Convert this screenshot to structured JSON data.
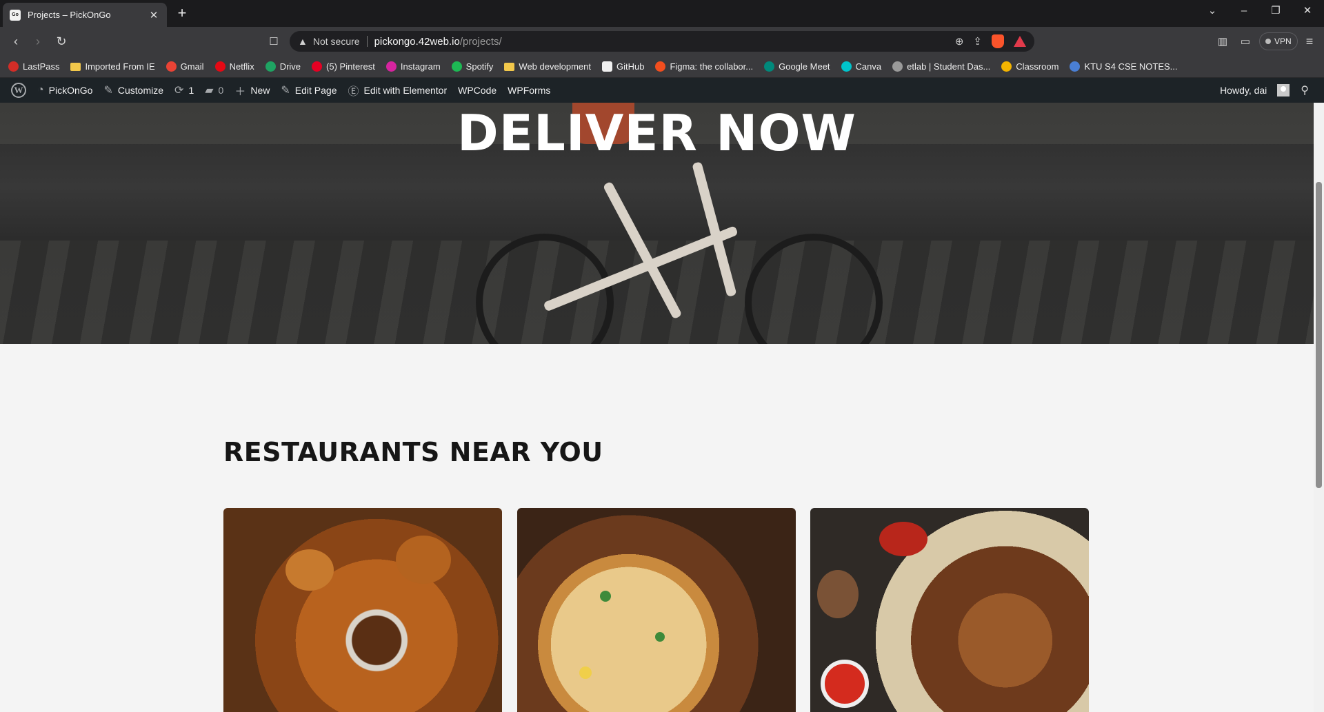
{
  "browser": {
    "tab": {
      "title": "Projects – PickOnGo",
      "favicon_text": "Go"
    },
    "url": {
      "security_label": "Not secure",
      "host": "pickongo.42web.io",
      "path": "/projects/"
    },
    "vpn_label": "VPN"
  },
  "bookmarks": [
    {
      "label": "LastPass",
      "icon": "lastpass-icon",
      "color": "#d32d27"
    },
    {
      "label": "Imported From IE",
      "icon": "folder-icon",
      "color": "#f2c84b"
    },
    {
      "label": "Gmail",
      "icon": "gmail-icon",
      "color": "#ea4335"
    },
    {
      "label": "Netflix",
      "icon": "netflix-icon",
      "color": "#e50914"
    },
    {
      "label": "Drive",
      "icon": "drive-icon",
      "color": "#1fa463"
    },
    {
      "label": "(5) Pinterest",
      "icon": "pinterest-icon",
      "color": "#e60023"
    },
    {
      "label": "Instagram",
      "icon": "instagram-icon",
      "color": "#d6249f"
    },
    {
      "label": "Spotify",
      "icon": "spotify-icon",
      "color": "#1db954"
    },
    {
      "label": "Web development",
      "icon": "folder-icon",
      "color": "#f2c84b"
    },
    {
      "label": "GitHub",
      "icon": "github-icon",
      "color": "#f0f0f0"
    },
    {
      "label": "Figma: the collabor...",
      "icon": "figma-icon",
      "color": "#f24e1e"
    },
    {
      "label": "Google Meet",
      "icon": "meet-icon",
      "color": "#00897b"
    },
    {
      "label": "Canva",
      "icon": "canva-icon",
      "color": "#00c4cc"
    },
    {
      "label": "etlab | Student Das...",
      "icon": "globe-icon",
      "color": "#9a9a9a"
    },
    {
      "label": "Classroom",
      "icon": "classroom-icon",
      "color": "#f4b400"
    },
    {
      "label": "KTU S4 CSE NOTES...",
      "icon": "ktu-icon",
      "color": "#4a7fd4"
    }
  ],
  "adminbar": {
    "site_name": "PickOnGo",
    "customize": "Customize",
    "updates_count": "1",
    "comments_count": "0",
    "new_label": "New",
    "edit_page": "Edit Page",
    "elementor": "Edit with Elementor",
    "wpcode": "WPCode",
    "wpforms": "WPForms",
    "howdy": "Howdy, dai"
  },
  "page": {
    "hero_title": "DELIVER NOW",
    "section_title": "RESTAURANTS NEAR YOU",
    "cards": [
      {
        "image": "fried-chicken-image"
      },
      {
        "image": "pizza-image"
      },
      {
        "image": "grilled-kebab-image"
      }
    ]
  }
}
